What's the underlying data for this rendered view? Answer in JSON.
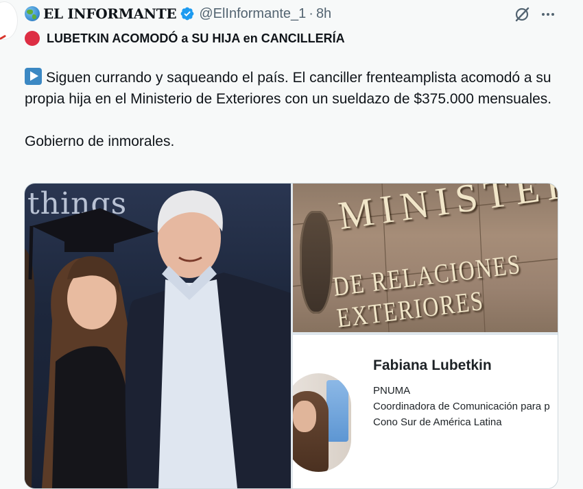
{
  "tweet": {
    "author_name": "EL INFORMANTE",
    "handle": "@ElInformante_1",
    "separator": "·",
    "time": "8h",
    "headline": "LUBETKIN ACOMODÓ a SU HIJA en CANCILLERÍA",
    "paragraph1": "Siguen currando y saqueando el país. El canciller frenteamplista acomodó a su propia hija en el Ministerio de Exteriores con un sueldazo de $375.000 mensuales.",
    "paragraph2": "Gobierno de inmorales."
  },
  "media": {
    "photo_left_text": "things",
    "sign_line1": "MINISTERIO",
    "sign_line2": "DE RELACIONES EXTERIORES",
    "profile": {
      "name": "Fabiana Lubetkin",
      "org": "PNUMA",
      "role": "Coordinadora de Comunicación para p",
      "region": "Cono Sur de América Latina"
    }
  },
  "icons": {
    "globe": "globe-emoji-icon",
    "verified": "verified-badge-icon",
    "grok": "grok-icon",
    "more": "more-icon",
    "red_circle": "red-circle-emoji-icon",
    "play": "play-button-emoji-icon"
  },
  "colors": {
    "verified_blue": "#1d9bf0",
    "text_primary": "#0f1419",
    "text_secondary": "#536471",
    "red_circle": "#dd2e44",
    "play_blue": "#3b88c3"
  }
}
